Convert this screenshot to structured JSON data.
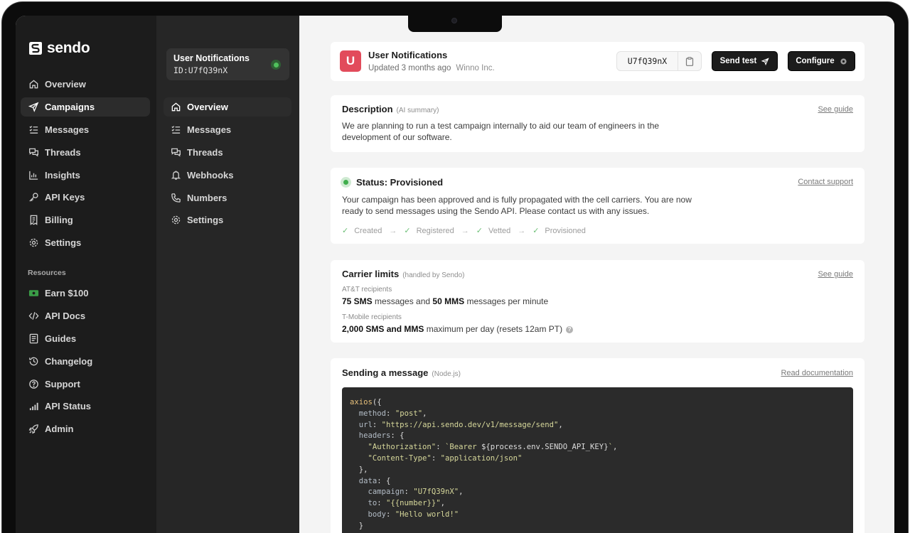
{
  "brand": {
    "name": "sendo"
  },
  "sidebar": {
    "items": [
      {
        "label": "Overview",
        "icon": "home-icon"
      },
      {
        "label": "Campaigns",
        "icon": "send-icon",
        "active": true
      },
      {
        "label": "Messages",
        "icon": "list-icon"
      },
      {
        "label": "Threads",
        "icon": "chat-icon"
      },
      {
        "label": "Insights",
        "icon": "chart-icon"
      },
      {
        "label": "API Keys",
        "icon": "key-icon"
      },
      {
        "label": "Billing",
        "icon": "receipt-icon"
      },
      {
        "label": "Settings",
        "icon": "gear-icon"
      }
    ],
    "resources_label": "Resources",
    "resources": [
      {
        "label": "Earn $100",
        "icon": "money-icon"
      },
      {
        "label": "API Docs",
        "icon": "code-icon"
      },
      {
        "label": "Guides",
        "icon": "book-icon"
      },
      {
        "label": "Changelog",
        "icon": "history-icon"
      },
      {
        "label": "Support",
        "icon": "help-icon"
      },
      {
        "label": "API Status",
        "icon": "signal-icon"
      },
      {
        "label": "Admin",
        "icon": "rocket-icon"
      }
    ]
  },
  "campaign_sidebar": {
    "title": "User Notifications",
    "id_text": "ID:U7fQ39nX",
    "status_color": "#50c05c",
    "items": [
      {
        "label": "Overview",
        "icon": "home-icon",
        "active": true
      },
      {
        "label": "Messages",
        "icon": "list-icon"
      },
      {
        "label": "Threads",
        "icon": "chat-icon"
      },
      {
        "label": "Webhooks",
        "icon": "bell-icon"
      },
      {
        "label": "Numbers",
        "icon": "phone-icon"
      },
      {
        "label": "Settings",
        "icon": "gear-icon"
      }
    ]
  },
  "header": {
    "badge": "U",
    "title": "User Notifications",
    "updated": "Updated 3 months ago",
    "org": "Winno Inc.",
    "campaign_id": "U7fQ39nX",
    "send_test_label": "Send test",
    "configure_label": "Configure",
    "badge_color": "#e24b5b"
  },
  "description": {
    "title": "Description",
    "tag": "(AI summary)",
    "link": "See guide",
    "line1": "We are planning to run a test campaign internally to aid our team of engineers in the",
    "line2": "development of our software."
  },
  "status": {
    "title": "Status: Provisioned",
    "link": "Contact support",
    "line1": "Your campaign has been approved and is fully propagated with the cell carriers. You are now",
    "line2": "ready to send messages using the Sendo API. Please contact us with any issues.",
    "steps": [
      "Created",
      "Registered",
      "Vetted",
      "Provisioned"
    ]
  },
  "carrier": {
    "title": "Carrier limits",
    "tag": "(handled by Sendo)",
    "link": "See guide",
    "att_label": "AT&T recipients",
    "att_sms": "75 SMS",
    "att_mid": "messages and",
    "att_mms": "50 MMS",
    "att_tail": "messages per minute",
    "tmo_label": "T-Mobile recipients",
    "tmo_bold": "2,000 SMS and MMS",
    "tmo_tail": "maximum per day (resets 12am PT)",
    "help": "?"
  },
  "sending": {
    "title": "Sending a message",
    "tag": "(Node.js)",
    "link": "Read documentation",
    "code": {
      "fn": "axios",
      "open": "({",
      "method_key": "method",
      "method_val": "\"post\"",
      "url_key": "url",
      "url_val": "\"https://api.sendo.dev/v1/message/send\"",
      "headers_key": "headers",
      "auth_key": "\"Authorization\"",
      "auth_val_a": "`Bearer ",
      "auth_val_b": "${process.env.SENDO_API_KEY}",
      "auth_val_c": "`",
      "ct_key": "\"Content-Type\"",
      "ct_val": "\"application/json\"",
      "data_key": "data",
      "campaign_key": "campaign",
      "campaign_val": "\"U7fQ39nX\"",
      "to_key": "to",
      "to_val": "\"{{number}}\"",
      "body_key": "body",
      "body_val": "\"Hello world!\""
    }
  }
}
